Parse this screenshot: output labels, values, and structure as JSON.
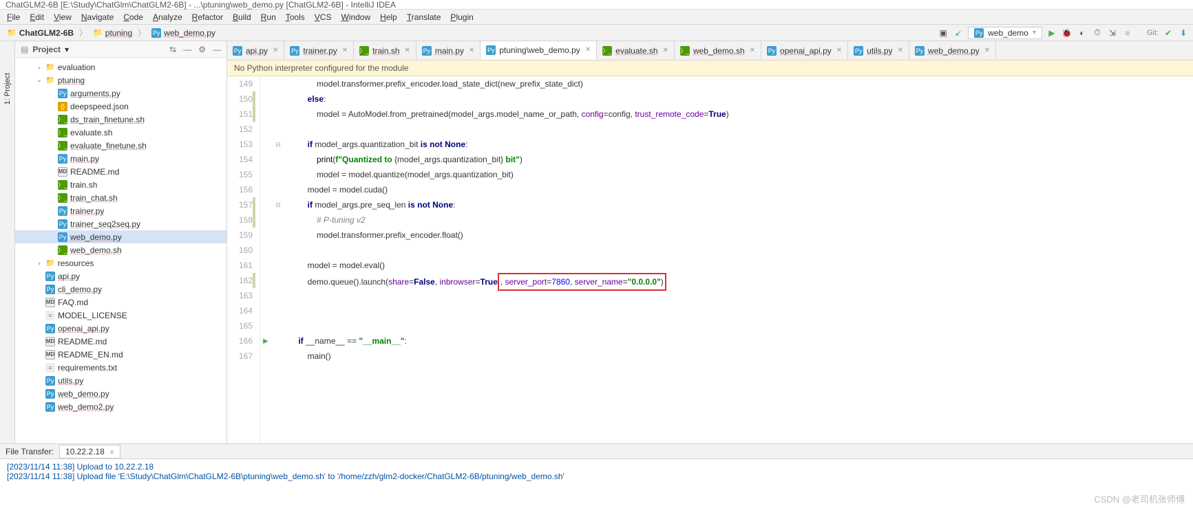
{
  "window_title": "ChatGLM2-6B [E:\\Study\\ChatGlm\\ChatGLM2-6B] - ...\\ptuning\\web_demo.py [ChatGLM2-6B] - IntelliJ IDEA",
  "menu": [
    "File",
    "Edit",
    "View",
    "Navigate",
    "Code",
    "Analyze",
    "Refactor",
    "Build",
    "Run",
    "Tools",
    "VCS",
    "Window",
    "Help",
    "Translate",
    "Plugin"
  ],
  "breadcrumb": {
    "root": "ChatGLM2-6B",
    "folder": "ptuning",
    "file": "web_demo.py"
  },
  "run_config_label": "web_demo",
  "git_label": "Git:",
  "project_panel_title": "Project",
  "tree": [
    {
      "indent": 1,
      "caret": ">",
      "type": "folder",
      "name": "evaluation"
    },
    {
      "indent": 1,
      "caret": "v",
      "type": "folder",
      "name": "ptuning",
      "ul": true
    },
    {
      "indent": 2,
      "caret": "",
      "type": "py",
      "name": "arguments.py",
      "ul": true
    },
    {
      "indent": 2,
      "caret": "",
      "type": "json",
      "name": "deepspeed.json"
    },
    {
      "indent": 2,
      "caret": "",
      "type": "sh",
      "name": "ds_train_finetune.sh",
      "ul": true
    },
    {
      "indent": 2,
      "caret": "",
      "type": "sh",
      "name": "evaluate.sh"
    },
    {
      "indent": 2,
      "caret": "",
      "type": "sh",
      "name": "evaluate_finetune.sh",
      "ul": true
    },
    {
      "indent": 2,
      "caret": "",
      "type": "py",
      "name": "main.py",
      "ul": true
    },
    {
      "indent": 2,
      "caret": "",
      "type": "md",
      "name": "README.md"
    },
    {
      "indent": 2,
      "caret": "",
      "type": "sh",
      "name": "train.sh"
    },
    {
      "indent": 2,
      "caret": "",
      "type": "sh",
      "name": "train_chat.sh",
      "ul": true
    },
    {
      "indent": 2,
      "caret": "",
      "type": "py",
      "name": "trainer.py",
      "ul": true
    },
    {
      "indent": 2,
      "caret": "",
      "type": "py",
      "name": "trainer_seq2seq.py",
      "ul": true
    },
    {
      "indent": 2,
      "caret": "",
      "type": "py",
      "name": "web_demo.py",
      "selected": true,
      "ul": true
    },
    {
      "indent": 2,
      "caret": "",
      "type": "sh",
      "name": "web_demo.sh",
      "ul": true
    },
    {
      "indent": 1,
      "caret": ">",
      "type": "folder",
      "name": "resources"
    },
    {
      "indent": 1,
      "caret": "",
      "type": "py",
      "name": "api.py",
      "ul": true
    },
    {
      "indent": 1,
      "caret": "",
      "type": "py",
      "name": "cli_demo.py",
      "ul": true
    },
    {
      "indent": 1,
      "caret": "",
      "type": "md",
      "name": "FAQ.md"
    },
    {
      "indent": 1,
      "caret": "",
      "type": "txt",
      "name": "MODEL_LICENSE"
    },
    {
      "indent": 1,
      "caret": "",
      "type": "py",
      "name": "openai_api.py",
      "ul": true
    },
    {
      "indent": 1,
      "caret": "",
      "type": "md",
      "name": "README.md"
    },
    {
      "indent": 1,
      "caret": "",
      "type": "md",
      "name": "README_EN.md"
    },
    {
      "indent": 1,
      "caret": "",
      "type": "txt",
      "name": "requirements.txt"
    },
    {
      "indent": 1,
      "caret": "",
      "type": "py",
      "name": "utils.py",
      "ul": true
    },
    {
      "indent": 1,
      "caret": "",
      "type": "py",
      "name": "web_demo.py",
      "ul": true
    },
    {
      "indent": 1,
      "caret": "",
      "type": "py",
      "name": "web_demo2.py",
      "ul": true
    }
  ],
  "tabs": [
    {
      "icon": "py",
      "label": "api.py"
    },
    {
      "icon": "py",
      "label": "trainer.py"
    },
    {
      "icon": "sh",
      "label": "train.sh"
    },
    {
      "icon": "py",
      "label": "main.py"
    },
    {
      "icon": "py",
      "label": "ptuning\\web_demo.py",
      "active": true
    },
    {
      "icon": "sh",
      "label": "evaluate.sh"
    },
    {
      "icon": "sh",
      "label": "web_demo.sh"
    },
    {
      "icon": "py",
      "label": "openai_api.py"
    },
    {
      "icon": "py",
      "label": "utils.py"
    },
    {
      "icon": "py",
      "label": "web_demo.py"
    }
  ],
  "banner": "No Python interpreter configured for the module",
  "gutter_start": 149,
  "mod_lines": [
    150,
    151,
    157,
    158,
    162
  ],
  "fold_lines": {
    "153": "-",
    "157": "-"
  },
  "run_triangle_line": 166,
  "code_lines": [
    "            model.transformer.prefix_encoder.load_state_dict(new_prefix_state_dict)",
    "        <kw>else</kw>:",
    "            model = AutoModel.from_pretrained(model_args.model_name_or_path, <arg>config</arg>=config, <arg>trust_remote_code</arg>=<kw>True</kw>)",
    "",
    "        <kw>if</kw> model_args.quantization_bit <kw>is not</kw> <kw>None</kw>:",
    "            <fn>print</fn>(<str>f\"Quantized to </str>{model_args.quantization_bit}<str> bit\"</str>)",
    "            model = model.quantize(model_args.quantization_bit)",
    "        model = model.cuda()",
    "        <kw>if</kw> model_args.pre_seq_len <kw>is not</kw> <kw>None</kw>:",
    "            <cmt># P-tuning v2</cmt>",
    "            model.transformer.prefix_encoder.float()",
    "",
    "        model = model.eval()",
    "        demo.queue().launch(<arg>share</arg>=<kw>False</kw>, <arg>inbrowser</arg>=<kw>True</kw><hl>, <arg>server_port</arg>=<num>7860</num>, <arg>server_name</arg>=<str>\"0.0.0.0\"</str>)</hl>",
    "",
    "",
    "",
    "    <kw>if</kw> __name__ == <str>\"__main__\"</str>:",
    "        main()"
  ],
  "bottom_tabs": {
    "label": "File Transfer:",
    "host": "10.22.2.18"
  },
  "console_lines": [
    "[2023/11/14 11:38] Upload to 10.22.2.18",
    "[2023/11/14 11:38] Upload file 'E:\\Study\\ChatGlm\\ChatGLM2-6B\\ptuning\\web_demo.sh' to '/home/zzh/glm2-docker/ChatGLM2-6B/ptuning/web_demo.sh'"
  ],
  "watermark": "CSDN @老司机张师傅"
}
